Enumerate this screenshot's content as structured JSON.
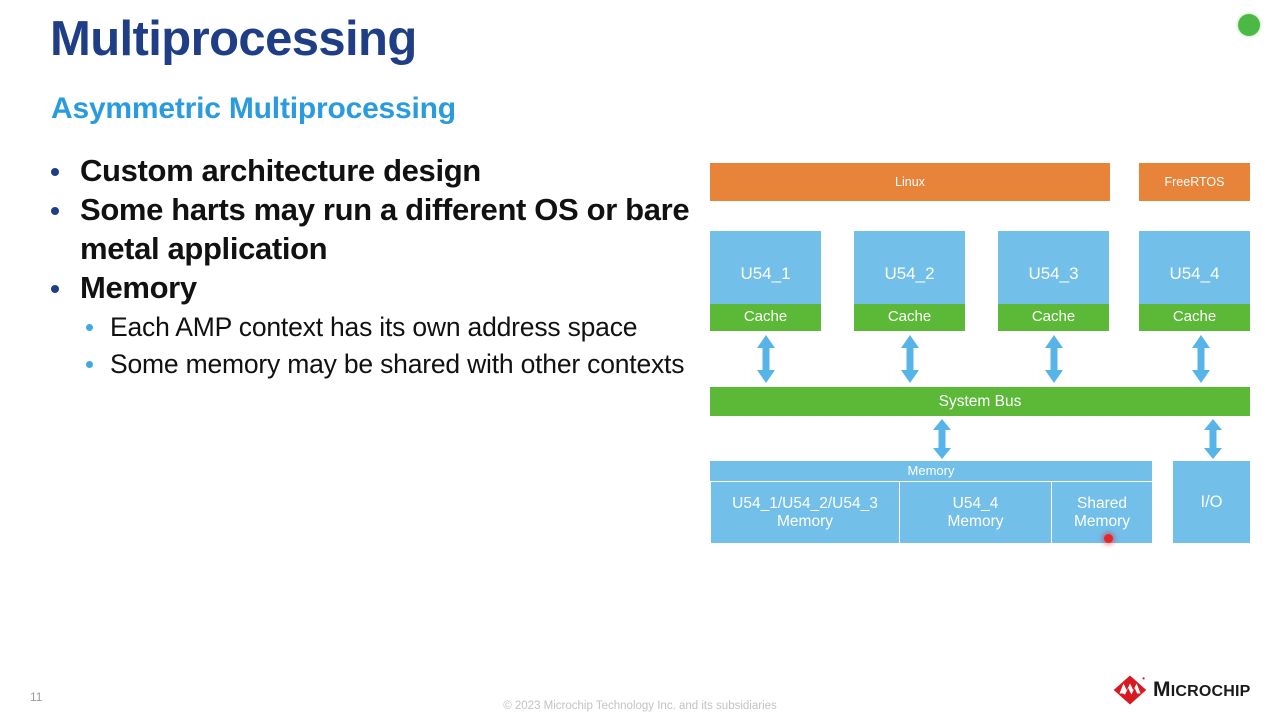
{
  "slide": {
    "title": "Multiprocessing",
    "subtitle": "Asymmetric Multiprocessing",
    "title_color": "#1F3E86",
    "subtitle_color": "#2B9BE0",
    "number": "11",
    "copyright": "© 2023 Microchip Technology Inc. and its subsidiaries",
    "recording_indicator": "green-dot-icon",
    "laser_pointer": "red-laser-dot-icon"
  },
  "bullets": [
    {
      "level": 1,
      "text": "Custom architecture design"
    },
    {
      "level": 1,
      "text": "Some harts may run a different OS or bare metal application"
    },
    {
      "level": 1,
      "text": "Memory"
    },
    {
      "level": 2,
      "text": "Each AMP context has its own address space"
    },
    {
      "level": 2,
      "text": "Some memory may be shared with other contexts"
    }
  ],
  "diagram": {
    "colors": {
      "os": "#E8833A",
      "core": "#72BFEA",
      "cache": "#5CB837",
      "bus": "#5CB837",
      "memory": "#72BFEA",
      "arrow": "#57B4E8"
    },
    "os_bars": [
      {
        "label": "Linux",
        "spans_cores": [
          "U54_1",
          "U54_2",
          "U54_3"
        ]
      },
      {
        "label": "FreeRTOS",
        "spans_cores": [
          "U54_4"
        ]
      }
    ],
    "cores": [
      {
        "label": "U54_1",
        "cache_label": "Cache"
      },
      {
        "label": "U54_2",
        "cache_label": "Cache"
      },
      {
        "label": "U54_3",
        "cache_label": "Cache"
      },
      {
        "label": "U54_4",
        "cache_label": "Cache"
      }
    ],
    "bus": {
      "label": "System Bus"
    },
    "memory": {
      "header": "Memory",
      "regions": [
        {
          "line1": "U54_1/U54_2/U54_3",
          "line2": "Memory"
        },
        {
          "line1": "U54_4",
          "line2": "Memory"
        },
        {
          "line1": "Shared",
          "line2": "Memory"
        }
      ]
    },
    "io": {
      "label": "I/O"
    }
  },
  "logo": {
    "mark": "microchip-diamond-icon",
    "word_first": "M",
    "word_rest": "ICROCHIP"
  }
}
